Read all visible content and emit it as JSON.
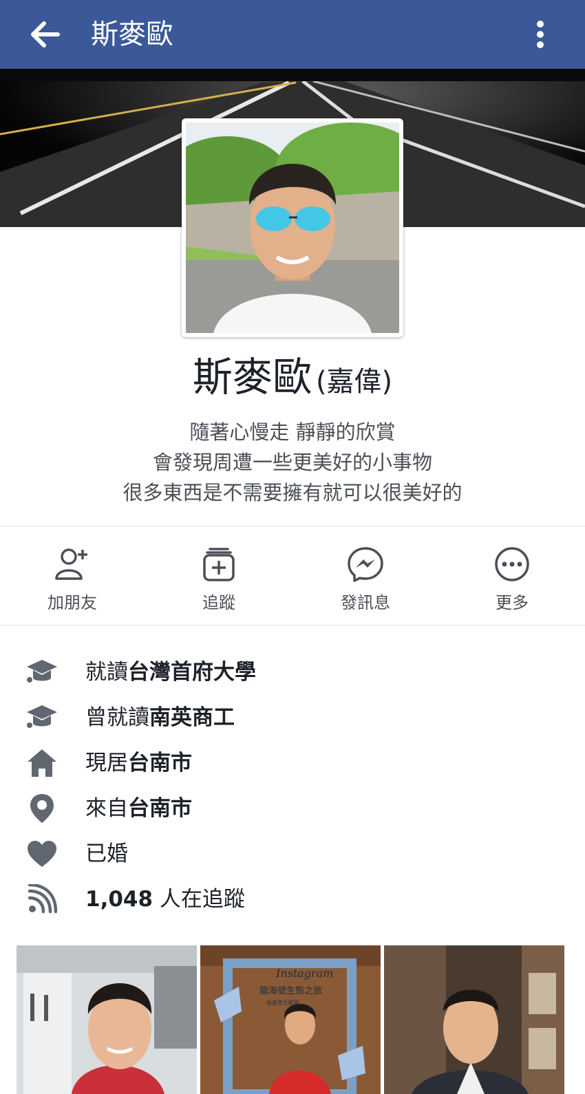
{
  "header": {
    "title": "斯麥歐",
    "back_icon": "back-arrow-icon",
    "menu_icon": "more-vertical-icon",
    "bar_color": "#3b5998"
  },
  "profile": {
    "name": "斯麥歐",
    "alternate_name": "(嘉偉)",
    "bio": [
      "隨著心慢走 靜靜的欣賞",
      "會發現周遭一些更美好的小事物",
      "很多東西是不需要擁有就可以很美好的"
    ]
  },
  "actions": [
    {
      "label": "加朋友",
      "icon": "add-friend-icon"
    },
    {
      "label": "追蹤",
      "icon": "follow-icon"
    },
    {
      "label": "發訊息",
      "icon": "messenger-icon"
    },
    {
      "label": "更多",
      "icon": "more-horizontal-icon"
    }
  ],
  "info": [
    {
      "prefix": "就讀",
      "strong": "台灣首府大學",
      "suffix": "",
      "icon": "graduation-cap-icon"
    },
    {
      "prefix": "曾就讀",
      "strong": "南英商工",
      "suffix": "",
      "icon": "graduation-cap-icon"
    },
    {
      "prefix": "現居",
      "strong": "台南市",
      "suffix": "",
      "icon": "home-icon"
    },
    {
      "prefix": "來自",
      "strong": "台南市",
      "suffix": "",
      "icon": "location-pin-icon"
    },
    {
      "prefix": "",
      "strong": "",
      "suffix": "已婚",
      "icon": "heart-icon"
    },
    {
      "prefix": "",
      "strong": "1,048",
      "suffix": " 人在追蹤",
      "icon": "followers-rss-icon"
    }
  ],
  "photo_strip": {
    "sign_brand": "Instagram",
    "sign_text": "龍海號生態之旅",
    "sign_subtext": "台南市七股區"
  }
}
